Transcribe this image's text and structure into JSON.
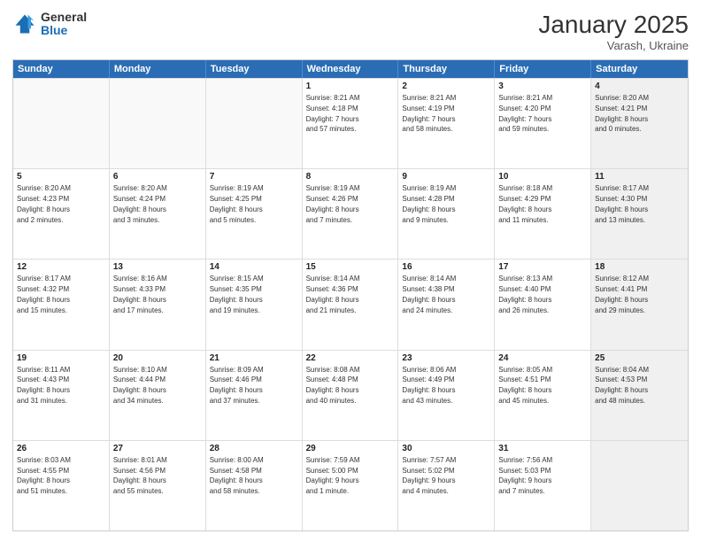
{
  "logo": {
    "general": "General",
    "blue": "Blue"
  },
  "header": {
    "month": "January 2025",
    "location": "Varash, Ukraine"
  },
  "days": [
    "Sunday",
    "Monday",
    "Tuesday",
    "Wednesday",
    "Thursday",
    "Friday",
    "Saturday"
  ],
  "weeks": [
    [
      {
        "day": "",
        "empty": true
      },
      {
        "day": "",
        "empty": true
      },
      {
        "day": "",
        "empty": true
      },
      {
        "day": "1",
        "line1": "Sunrise: 8:21 AM",
        "line2": "Sunset: 4:18 PM",
        "line3": "Daylight: 7 hours",
        "line4": "and 57 minutes."
      },
      {
        "day": "2",
        "line1": "Sunrise: 8:21 AM",
        "line2": "Sunset: 4:19 PM",
        "line3": "Daylight: 7 hours",
        "line4": "and 58 minutes."
      },
      {
        "day": "3",
        "line1": "Sunrise: 8:21 AM",
        "line2": "Sunset: 4:20 PM",
        "line3": "Daylight: 7 hours",
        "line4": "and 59 minutes."
      },
      {
        "day": "4",
        "line1": "Sunrise: 8:20 AM",
        "line2": "Sunset: 4:21 PM",
        "line3": "Daylight: 8 hours",
        "line4": "and 0 minutes.",
        "shaded": true
      }
    ],
    [
      {
        "day": "5",
        "line1": "Sunrise: 8:20 AM",
        "line2": "Sunset: 4:23 PM",
        "line3": "Daylight: 8 hours",
        "line4": "and 2 minutes."
      },
      {
        "day": "6",
        "line1": "Sunrise: 8:20 AM",
        "line2": "Sunset: 4:24 PM",
        "line3": "Daylight: 8 hours",
        "line4": "and 3 minutes."
      },
      {
        "day": "7",
        "line1": "Sunrise: 8:19 AM",
        "line2": "Sunset: 4:25 PM",
        "line3": "Daylight: 8 hours",
        "line4": "and 5 minutes."
      },
      {
        "day": "8",
        "line1": "Sunrise: 8:19 AM",
        "line2": "Sunset: 4:26 PM",
        "line3": "Daylight: 8 hours",
        "line4": "and 7 minutes."
      },
      {
        "day": "9",
        "line1": "Sunrise: 8:19 AM",
        "line2": "Sunset: 4:28 PM",
        "line3": "Daylight: 8 hours",
        "line4": "and 9 minutes."
      },
      {
        "day": "10",
        "line1": "Sunrise: 8:18 AM",
        "line2": "Sunset: 4:29 PM",
        "line3": "Daylight: 8 hours",
        "line4": "and 11 minutes."
      },
      {
        "day": "11",
        "line1": "Sunrise: 8:17 AM",
        "line2": "Sunset: 4:30 PM",
        "line3": "Daylight: 8 hours",
        "line4": "and 13 minutes.",
        "shaded": true
      }
    ],
    [
      {
        "day": "12",
        "line1": "Sunrise: 8:17 AM",
        "line2": "Sunset: 4:32 PM",
        "line3": "Daylight: 8 hours",
        "line4": "and 15 minutes."
      },
      {
        "day": "13",
        "line1": "Sunrise: 8:16 AM",
        "line2": "Sunset: 4:33 PM",
        "line3": "Daylight: 8 hours",
        "line4": "and 17 minutes."
      },
      {
        "day": "14",
        "line1": "Sunrise: 8:15 AM",
        "line2": "Sunset: 4:35 PM",
        "line3": "Daylight: 8 hours",
        "line4": "and 19 minutes."
      },
      {
        "day": "15",
        "line1": "Sunrise: 8:14 AM",
        "line2": "Sunset: 4:36 PM",
        "line3": "Daylight: 8 hours",
        "line4": "and 21 minutes."
      },
      {
        "day": "16",
        "line1": "Sunrise: 8:14 AM",
        "line2": "Sunset: 4:38 PM",
        "line3": "Daylight: 8 hours",
        "line4": "and 24 minutes."
      },
      {
        "day": "17",
        "line1": "Sunrise: 8:13 AM",
        "line2": "Sunset: 4:40 PM",
        "line3": "Daylight: 8 hours",
        "line4": "and 26 minutes."
      },
      {
        "day": "18",
        "line1": "Sunrise: 8:12 AM",
        "line2": "Sunset: 4:41 PM",
        "line3": "Daylight: 8 hours",
        "line4": "and 29 minutes.",
        "shaded": true
      }
    ],
    [
      {
        "day": "19",
        "line1": "Sunrise: 8:11 AM",
        "line2": "Sunset: 4:43 PM",
        "line3": "Daylight: 8 hours",
        "line4": "and 31 minutes."
      },
      {
        "day": "20",
        "line1": "Sunrise: 8:10 AM",
        "line2": "Sunset: 4:44 PM",
        "line3": "Daylight: 8 hours",
        "line4": "and 34 minutes."
      },
      {
        "day": "21",
        "line1": "Sunrise: 8:09 AM",
        "line2": "Sunset: 4:46 PM",
        "line3": "Daylight: 8 hours",
        "line4": "and 37 minutes."
      },
      {
        "day": "22",
        "line1": "Sunrise: 8:08 AM",
        "line2": "Sunset: 4:48 PM",
        "line3": "Daylight: 8 hours",
        "line4": "and 40 minutes."
      },
      {
        "day": "23",
        "line1": "Sunrise: 8:06 AM",
        "line2": "Sunset: 4:49 PM",
        "line3": "Daylight: 8 hours",
        "line4": "and 43 minutes."
      },
      {
        "day": "24",
        "line1": "Sunrise: 8:05 AM",
        "line2": "Sunset: 4:51 PM",
        "line3": "Daylight: 8 hours",
        "line4": "and 45 minutes."
      },
      {
        "day": "25",
        "line1": "Sunrise: 8:04 AM",
        "line2": "Sunset: 4:53 PM",
        "line3": "Daylight: 8 hours",
        "line4": "and 48 minutes.",
        "shaded": true
      }
    ],
    [
      {
        "day": "26",
        "line1": "Sunrise: 8:03 AM",
        "line2": "Sunset: 4:55 PM",
        "line3": "Daylight: 8 hours",
        "line4": "and 51 minutes."
      },
      {
        "day": "27",
        "line1": "Sunrise: 8:01 AM",
        "line2": "Sunset: 4:56 PM",
        "line3": "Daylight: 8 hours",
        "line4": "and 55 minutes."
      },
      {
        "day": "28",
        "line1": "Sunrise: 8:00 AM",
        "line2": "Sunset: 4:58 PM",
        "line3": "Daylight: 8 hours",
        "line4": "and 58 minutes."
      },
      {
        "day": "29",
        "line1": "Sunrise: 7:59 AM",
        "line2": "Sunset: 5:00 PM",
        "line3": "Daylight: 9 hours",
        "line4": "and 1 minute."
      },
      {
        "day": "30",
        "line1": "Sunrise: 7:57 AM",
        "line2": "Sunset: 5:02 PM",
        "line3": "Daylight: 9 hours",
        "line4": "and 4 minutes."
      },
      {
        "day": "31",
        "line1": "Sunrise: 7:56 AM",
        "line2": "Sunset: 5:03 PM",
        "line3": "Daylight: 9 hours",
        "line4": "and 7 minutes."
      },
      {
        "day": "",
        "empty": true,
        "shaded": true
      }
    ]
  ]
}
